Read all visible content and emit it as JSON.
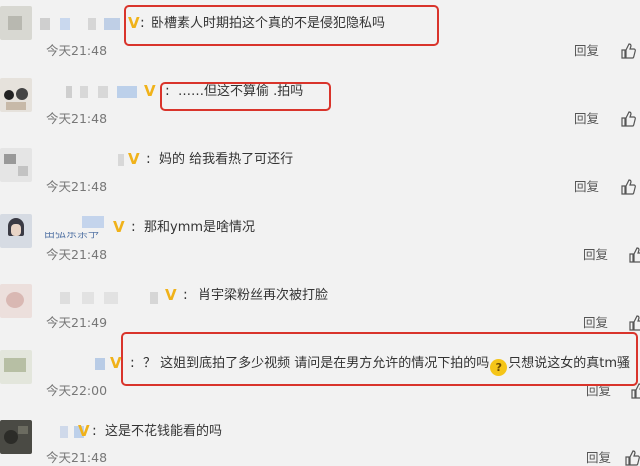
{
  "comments": [
    {
      "content": "卧槽素人时期拍这个真的不是侵犯隐私吗",
      "time": "今天21:48",
      "reply": "回复"
    },
    {
      "content": "……但这不算偷 .拍吗",
      "time": "今天21:48",
      "reply": "回复"
    },
    {
      "content": "妈的 给我看热了可还行",
      "time": "今天21:48",
      "reply": "回复"
    },
    {
      "content": "那和ymm是啥情况",
      "time": "今天21:48",
      "reply": "回复"
    },
    {
      "content": "肖宇梁粉丝再次被打脸",
      "time": "今天21:49",
      "reply": "回复"
    },
    {
      "content_a": "？ 这姐到底拍了多少视频 请问是在男方允许的情况下拍的吗",
      "content_b": "只想说这女的真tm骚",
      "time": "今天22:00",
      "reply": "回复"
    },
    {
      "content": "这是不花钱能看的吗",
      "time": "今天21:48",
      "reply": "回复"
    }
  ],
  "badge_glyph": "V",
  "colon": ":",
  "emoji_glyph": "?",
  "partial_username": "由弘东余予",
  "colors": {
    "highlight": "#d9342b",
    "badge": "#f0b21a",
    "background": "#f2f2f2"
  },
  "icons": {
    "like": "thumbs-up-icon",
    "emoji": "thinking-face-icon"
  }
}
